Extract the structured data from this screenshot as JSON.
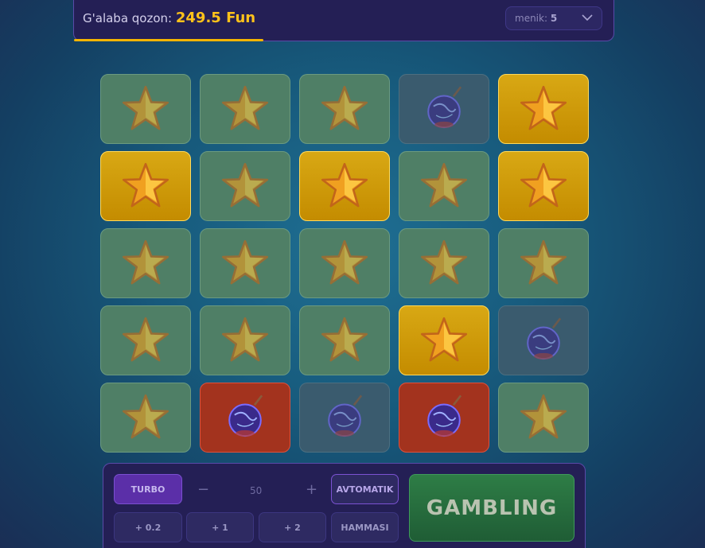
{
  "header": {
    "win_label": "G'alaba qozon:",
    "win_amount": "249.5 Fun",
    "progress": 0.35,
    "mines_label": "menik:",
    "mines_value": "5"
  },
  "grid": {
    "rows": 5,
    "cols": 5,
    "tiles": [
      "star-dim",
      "star-dim",
      "star-dim",
      "bomb-dim",
      "star-gold",
      "star-gold",
      "star-dim",
      "star-gold",
      "star-dim",
      "star-gold",
      "star-dim",
      "star-dim",
      "star-dim",
      "star-dim",
      "star-dim",
      "star-dim",
      "star-dim",
      "star-dim",
      "star-gold",
      "bomb-dim",
      "star-dim",
      "bomb-red",
      "bomb-dim",
      "bomb-red",
      "star-dim"
    ]
  },
  "controls": {
    "turbo": "TURBO",
    "minus": "−",
    "bet_value": "50",
    "plus": "+",
    "auto": "AVTOMATIK",
    "add_02": "+ 0.2",
    "add_1": "+ 1",
    "add_2": "+ 2",
    "all": "HAMMASI",
    "gamble": "GAMBLING"
  },
  "colors": {
    "accent_gold": "#ffc21a",
    "panel": "#241f55",
    "gamble_green": "#2e7d46"
  }
}
